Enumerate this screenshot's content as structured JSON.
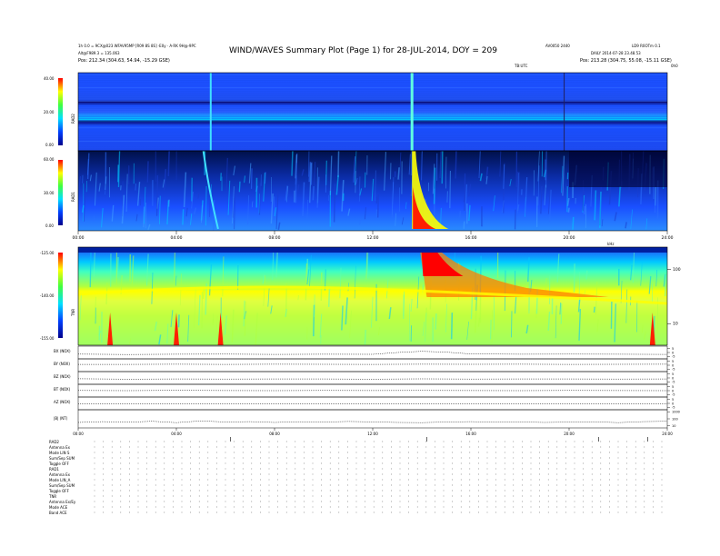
{
  "header": {
    "title": "WIND/WAVES Summary Plot (Page 1) for 28-JUL-2014, DOY = 209",
    "left_line1": "1h 0.0 = 9CX@023 WFAV95MP [R09 8S 8S] ·E0y · A·RK 9H@·9PC",
    "left_line2": "Alt@F989.3 = 135.063",
    "left_pos": "Pos:  212.34 (304.63, 54.94, -15.29 GSE)",
    "right_top1": "AV0050 2440",
    "right_top2": "LD9 R0OTm 0.1",
    "right_mid": "DAILY 2014-07-28 23.48.53",
    "right_pos": "Pos:  213.28 (304.75, 55.08, -15.11 GSE)",
    "ts_left": "TB:UTC",
    "ts_right": "0h0"
  },
  "panel_labels": {
    "rad2": "RAD2",
    "rad1": "RAD1",
    "tnr": "TNR",
    "bx": "BX (NOX)",
    "by": "BY (NOX)",
    "bz": "BZ (NOX)",
    "bt": "BT (NOX)",
    "az": "AZ (NOX)",
    "nt": "|B| (NT)",
    "khz": "kHz"
  },
  "icons": {
    "rad2": "colorbar-intensity",
    "rad1": "colorbar-intensity",
    "tnr": "colorbar-intensity",
    "bx": "line-trace",
    "by": "line-trace",
    "bz": "line-trace",
    "bt": "line-trace",
    "az": "line-trace",
    "nt": "line-trace"
  },
  "footer": {
    "line1": "RAD2",
    "line2": "Antenna    Ex",
    "line3": "Mode   LIN S",
    "line4": "Sum/Sep  SUM",
    "line5": "Toggle    OFF",
    "line6": "RAD1",
    "line7": "Antenna    Ex",
    "line8": "Mode   LIN_A",
    "line9": "Sum/Sep  SUM",
    "line10": "Toggle    OFF",
    "line11": "TNR",
    "line12": "Antenna  Ex/Ey",
    "line13": "Mode    ACE",
    "line14": "Band    ACE"
  },
  "colors": {
    "deep_blue": "#00008b",
    "blue": "#0040ff",
    "cyan": "#00e0ff",
    "green": "#40ff40",
    "yellow": "#ffff00",
    "orange": "#ff8000",
    "red": "#ff0000",
    "dark_red": "#800000"
  },
  "chart_data": [
    {
      "type": "heatmap",
      "name": "RAD2",
      "ylabel": "RAD2",
      "yticks": [
        "40.00",
        "20.00",
        "0.00"
      ],
      "ylim": [
        0,
        40
      ],
      "xlim": [
        0,
        24
      ]
    },
    {
      "type": "heatmap",
      "name": "RAD1",
      "ylabel": "RAD1",
      "yticks": [
        "60.00",
        "30.00",
        "0.00"
      ],
      "ylim": [
        0,
        60
      ],
      "xlim": [
        0,
        24
      ],
      "xticks": [
        "00:00",
        "04:00",
        "08:00",
        "12:00",
        "16:00",
        "20:00",
        "24:00"
      ],
      "x_values": [
        0,
        4,
        8,
        12,
        16,
        20,
        24
      ]
    },
    {
      "type": "heatmap",
      "name": "TNR",
      "ylabel": "TNR",
      "yticks": [
        "-125.00",
        "-140.00",
        "-155.00"
      ],
      "ylim": [
        -155,
        -125
      ],
      "xlim": [
        0,
        24
      ],
      "right_ticks": [
        "100",
        "10"
      ],
      "right_tick_values": [
        100,
        10
      ],
      "right_label": "kHz",
      "right_ylim": [
        4,
        256
      ],
      "log_scale_right": true,
      "spikes_hours": [
        1.3,
        4.0,
        5.8,
        23.4
      ]
    },
    {
      "type": "line",
      "name": "magnetometer",
      "xticks": [
        "00:00",
        "04:00",
        "08:00",
        "12:00",
        "16:00",
        "20:00",
        "24:00"
      ],
      "x_values": [
        0,
        4,
        8,
        12,
        16,
        20,
        24
      ],
      "xlim": [
        0,
        24
      ],
      "series": [
        {
          "name": "BX (NOX)",
          "right_ticks": [
            "5",
            "0",
            "-5"
          ],
          "right_tick_values": [
            5,
            0,
            -5
          ],
          "ylim": [
            -8,
            8
          ],
          "x": [
            0,
            2,
            4,
            6,
            8,
            10,
            12,
            13,
            14,
            15,
            16,
            18,
            20,
            22,
            24
          ],
          "values": [
            -2,
            -2.5,
            -2.2,
            -2,
            -2.4,
            -2.2,
            -2.3,
            0,
            1.5,
            0.5,
            -1.8,
            -2.2,
            -2,
            -2.2,
            -2.4
          ]
        },
        {
          "name": "BY (NOX)",
          "right_ticks": [
            "5",
            "0",
            "-5"
          ],
          "right_tick_values": [
            5,
            0,
            -5
          ],
          "ylim": [
            -8,
            8
          ],
          "x": [
            0,
            2,
            4,
            6,
            8,
            10,
            12,
            14,
            16,
            18,
            20,
            22,
            24
          ],
          "values": [
            1,
            1,
            1.2,
            1,
            1.3,
            1.1,
            1,
            1.2,
            1.1,
            1.2,
            1,
            1.1,
            1.2
          ]
        },
        {
          "name": "BZ (NOX)",
          "right_ticks": [
            "5",
            "0",
            "-5"
          ],
          "right_tick_values": [
            5,
            0,
            -5
          ],
          "ylim": [
            -8,
            8
          ],
          "x": [
            0,
            2,
            4,
            6,
            8,
            10,
            12,
            14,
            16,
            18,
            20,
            22,
            24
          ],
          "values": [
            -1,
            -1.5,
            -1.2,
            -1.4,
            -1.3,
            -1.2,
            -1.5,
            -1.1,
            -1.4,
            -1.2,
            -1.3,
            -1.4,
            -1.2
          ]
        },
        {
          "name": "BT (NOX)",
          "right_ticks": [
            "5",
            "0",
            "-5"
          ],
          "right_tick_values": [
            5,
            0,
            -5
          ],
          "ylim": [
            -8,
            8
          ],
          "x": [
            0,
            2,
            4,
            6,
            8,
            10,
            12,
            14,
            16,
            18,
            20,
            22,
            24
          ],
          "values": [
            0.2,
            0,
            0.3,
            0.1,
            0,
            0.2,
            0.1,
            0.2,
            0.1,
            0,
            0.2,
            0.1,
            0
          ]
        },
        {
          "name": "AZ (NOX)",
          "right_ticks": [
            "5",
            "0",
            "-5"
          ],
          "right_tick_values": [
            5,
            0,
            -5
          ],
          "ylim": [
            -8,
            8
          ],
          "x": [
            0,
            2,
            4,
            6,
            8,
            10,
            12,
            14,
            16,
            18,
            20,
            22,
            24
          ],
          "values": [
            -0.5,
            -0.4,
            -0.6,
            -0.5,
            -0.7,
            -0.4,
            -0.5,
            -0.6,
            -0.4,
            -0.5,
            -0.6,
            -0.5,
            -0.4
          ]
        },
        {
          "name": "|B| (NT)",
          "right_ticks": [
            "1000",
            "100",
            "10"
          ],
          "right_tick_values": [
            1000,
            100,
            10
          ],
          "ylim": [
            5,
            2000
          ],
          "log_scale": true,
          "x": [
            0,
            1,
            2,
            3,
            4,
            5,
            6,
            7,
            8,
            9,
            10,
            11,
            12,
            13,
            14,
            15,
            16,
            17,
            18,
            19,
            20,
            21,
            22,
            23,
            24
          ],
          "values": [
            30,
            40,
            32,
            45,
            28,
            50,
            35,
            40,
            30,
            38,
            34,
            42,
            36,
            30,
            28,
            35,
            40,
            32,
            36,
            30,
            34,
            38,
            28,
            40,
            45
          ]
        }
      ]
    }
  ]
}
